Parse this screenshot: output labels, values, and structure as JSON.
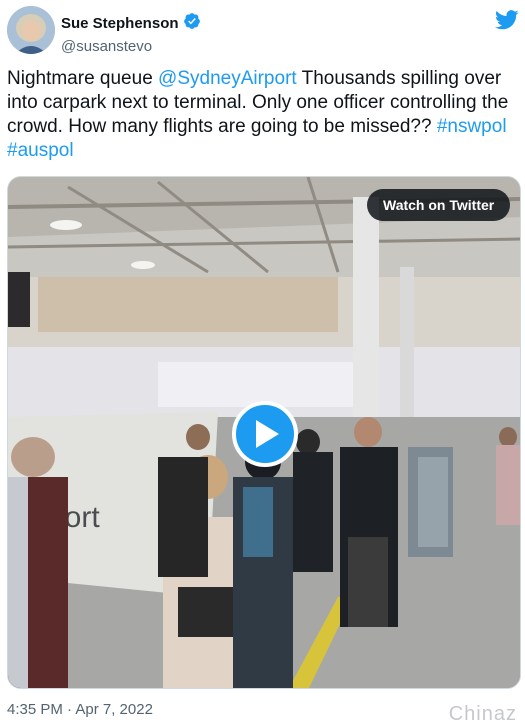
{
  "author": {
    "name": "Sue Stephenson",
    "handle": "@susanstevo",
    "verified": true
  },
  "tweet": {
    "text_parts": [
      {
        "text": "Nightmare queue ",
        "type": "text"
      },
      {
        "text": "@SydneyAirport",
        "type": "link"
      },
      {
        "text": " Thousands spilling over into carpark next to terminal. Only one officer controlling the crowd. How many flights are going to be missed?? ",
        "type": "text"
      },
      {
        "text": "#nswpol",
        "type": "link"
      },
      {
        "text": " ",
        "type": "text"
      },
      {
        "text": "#auspol",
        "type": "link"
      }
    ]
  },
  "media": {
    "watch_label": "Watch on Twitter",
    "sign_text": "port"
  },
  "timestamp": "4:35 PM · Apr 7, 2022",
  "watermark": "Chinaz",
  "colors": {
    "link": "#1d9bf0",
    "verified": "#1d9bf0",
    "muted": "#536471"
  },
  "icons": [
    "verified-badge-icon",
    "twitter-bird-icon",
    "play-icon"
  ]
}
